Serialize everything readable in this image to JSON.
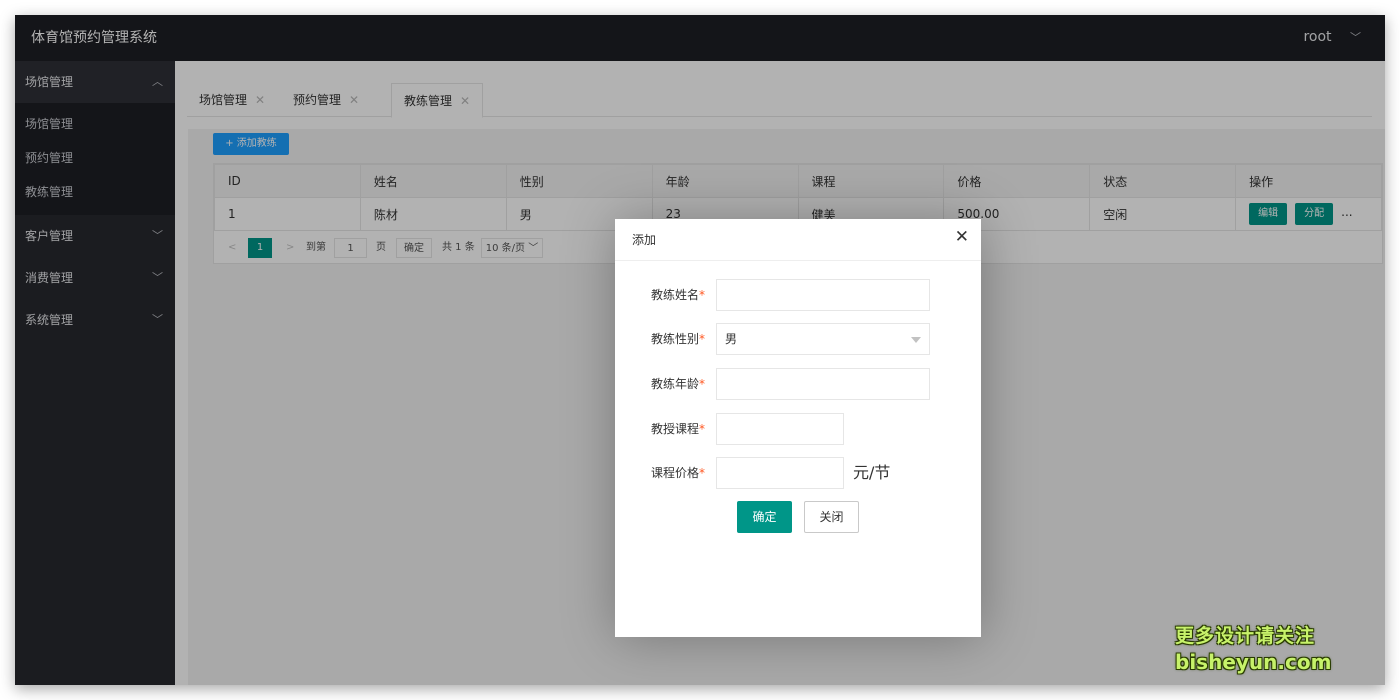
{
  "app": {
    "title": "体育馆预约管理系统",
    "user": "root"
  },
  "sidebar": {
    "groups": [
      {
        "label": "场馆管理",
        "open": true,
        "items": [
          "场馆管理",
          "预约管理",
          "教练管理"
        ]
      },
      {
        "label": "客户管理"
      },
      {
        "label": "消费管理"
      },
      {
        "label": "系统管理"
      }
    ]
  },
  "tabs": [
    {
      "label": "场馆管理"
    },
    {
      "label": "预约管理"
    },
    {
      "label": "教练管理",
      "active": true
    }
  ],
  "toolbar": {
    "add_label": "+ 添加教练"
  },
  "table": {
    "columns": [
      "ID",
      "姓名",
      "性别",
      "年龄",
      "课程",
      "价格",
      "状态",
      "操作"
    ],
    "rows": [
      {
        "id": "1",
        "name": "陈材",
        "gender": "男",
        "age": "23",
        "course": "健美",
        "price": "500.00",
        "status": "空闲",
        "actions": [
          "编辑",
          "分配"
        ],
        "more": "..."
      }
    ]
  },
  "pager": {
    "current": "1",
    "goto_label": "到第",
    "goto_value": "1",
    "page_unit": "页",
    "confirm": "确定",
    "total": "共 1 条",
    "page_size": "10 条/页"
  },
  "dialog": {
    "title": "添加",
    "fields": [
      {
        "label": "教练姓名",
        "value": ""
      },
      {
        "label": "教练性别",
        "value": "男"
      },
      {
        "label": "教练年龄",
        "value": ""
      },
      {
        "label": "教授课程",
        "value": ""
      },
      {
        "label": "课程价格",
        "value": "",
        "unit": "元/节"
      }
    ],
    "ok": "确定",
    "close": "关闭"
  },
  "watermark": {
    "line1": "更多设计请关注",
    "line2": "bisheyun.com"
  },
  "colors": {
    "primary": "#009688",
    "blue": "#1E9FFF",
    "sidebar": "#28292f"
  }
}
